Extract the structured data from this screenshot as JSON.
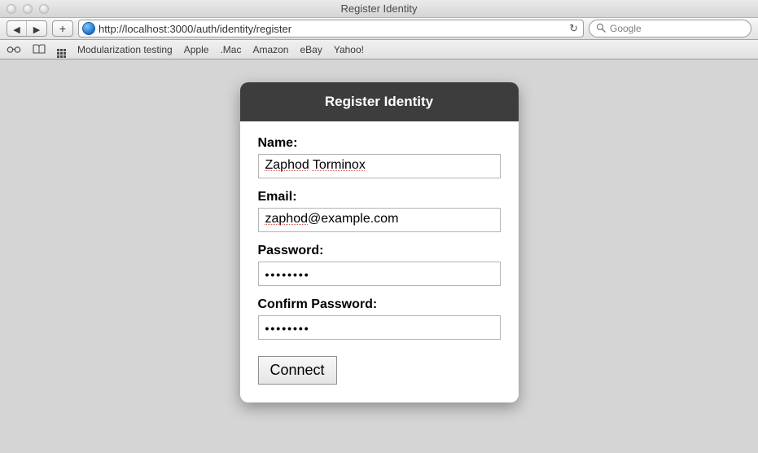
{
  "window": {
    "title": "Register Identity"
  },
  "toolbar": {
    "url": "http://localhost:3000/auth/identity/register",
    "search_placeholder": "Google"
  },
  "bookmarks": {
    "items": [
      "Modularization testing",
      "Apple",
      ".Mac",
      "Amazon",
      "eBay",
      "Yahoo!"
    ]
  },
  "form": {
    "heading": "Register Identity",
    "name_label": "Name:",
    "name_value_parts": [
      "Zaphod",
      " ",
      "Torminox"
    ],
    "email_label": "Email:",
    "email_value_parts": [
      "zaphod",
      "@example.com"
    ],
    "password_label": "Password:",
    "password_value": "••••••••",
    "confirm_label": "Confirm Password:",
    "confirm_value": "••••••••",
    "submit_label": "Connect"
  }
}
